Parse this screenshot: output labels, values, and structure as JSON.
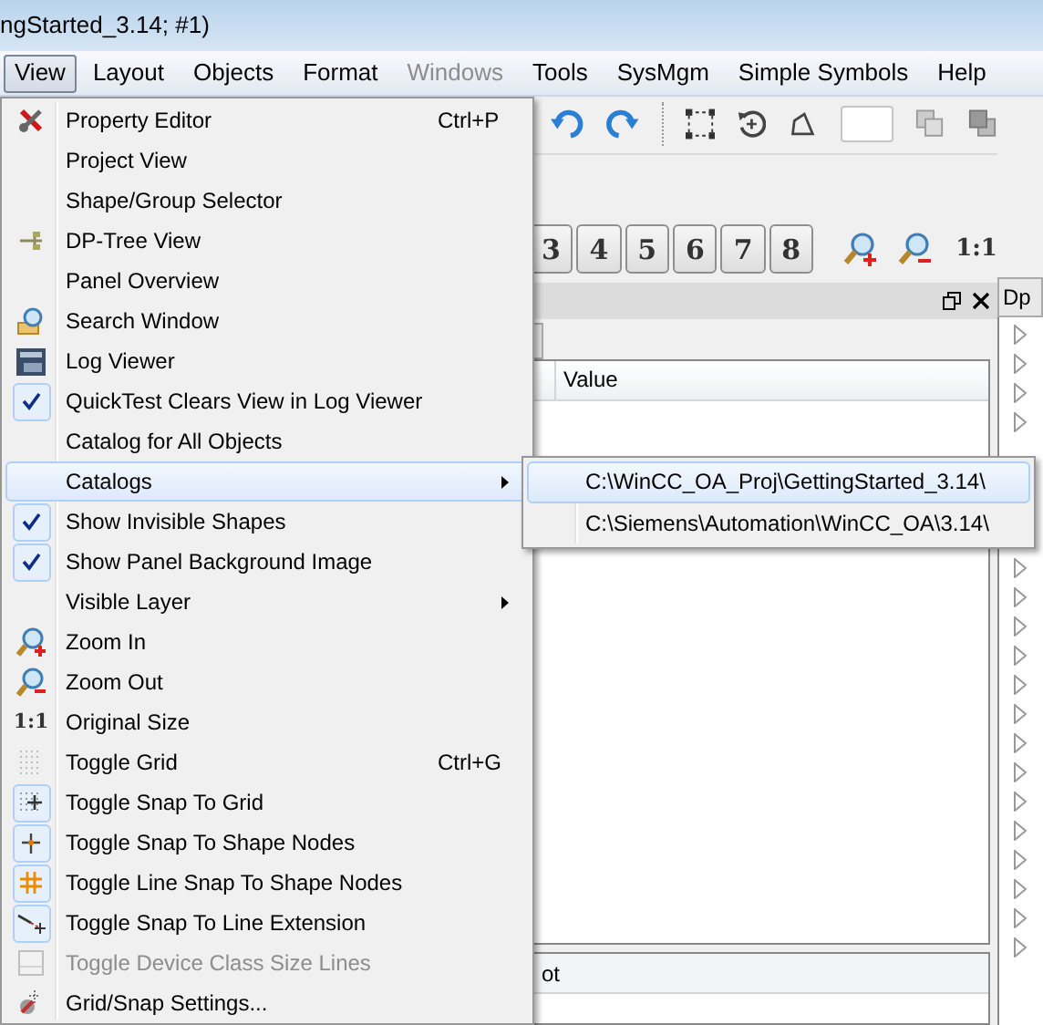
{
  "window": {
    "title": "ngStarted_3.14; #1)"
  },
  "menubar": [
    {
      "label": "View",
      "selected": true,
      "disabled": false
    },
    {
      "label": "Layout",
      "selected": false,
      "disabled": false
    },
    {
      "label": "Objects",
      "selected": false,
      "disabled": false
    },
    {
      "label": "Format",
      "selected": false,
      "disabled": false
    },
    {
      "label": "Windows",
      "selected": false,
      "disabled": true
    },
    {
      "label": "Tools",
      "selected": false,
      "disabled": false
    },
    {
      "label": "SysMgm",
      "selected": false,
      "disabled": false
    },
    {
      "label": "Simple Symbols",
      "selected": false,
      "disabled": false
    },
    {
      "label": "Help",
      "selected": false,
      "disabled": false
    }
  ],
  "background": {
    "layer_buttons": [
      "3",
      "4",
      "5",
      "6",
      "7",
      "8"
    ],
    "zoom_label": "1:1",
    "table_column": "Value",
    "side_tab": "Dp",
    "bottom_header": "ot"
  },
  "view_menu": [
    {
      "label": "Property Editor",
      "shortcut": "Ctrl+P",
      "checked": false,
      "disabled": false,
      "selected": false,
      "submenu": false
    },
    {
      "label": "Project View",
      "checked": false,
      "disabled": false,
      "selected": false,
      "submenu": false
    },
    {
      "label": "Shape/Group Selector",
      "checked": false,
      "disabled": false,
      "selected": false,
      "submenu": false
    },
    {
      "label": "DP-Tree View",
      "checked": false,
      "disabled": false,
      "selected": false,
      "submenu": false
    },
    {
      "label": "Panel Overview",
      "checked": false,
      "disabled": false,
      "selected": false,
      "submenu": false
    },
    {
      "label": "Search Window",
      "checked": false,
      "disabled": false,
      "selected": false,
      "submenu": false
    },
    {
      "label": "Log Viewer",
      "checked": false,
      "disabled": false,
      "selected": false,
      "submenu": false
    },
    {
      "label": "QuickTest Clears View in Log Viewer",
      "checked": true,
      "disabled": false,
      "selected": false,
      "submenu": false
    },
    {
      "label": "Catalog for All Objects",
      "checked": false,
      "disabled": false,
      "selected": false,
      "submenu": false
    },
    {
      "label": "Catalogs",
      "checked": false,
      "disabled": false,
      "selected": true,
      "submenu": true
    },
    {
      "label": "Show Invisible Shapes",
      "checked": true,
      "disabled": false,
      "selected": false,
      "submenu": false
    },
    {
      "label": "Show Panel Background Image",
      "checked": true,
      "disabled": false,
      "selected": false,
      "submenu": false
    },
    {
      "label": "Visible Layer",
      "checked": false,
      "disabled": false,
      "selected": false,
      "submenu": true
    },
    {
      "label": "Zoom In",
      "checked": false,
      "disabled": false,
      "selected": false,
      "submenu": false
    },
    {
      "label": "Zoom Out",
      "checked": false,
      "disabled": false,
      "selected": false,
      "submenu": false
    },
    {
      "label": "Original Size",
      "glyph": "1:1",
      "checked": false,
      "disabled": false,
      "selected": false,
      "submenu": false
    },
    {
      "label": "Toggle Grid",
      "shortcut": "Ctrl+G",
      "checked": false,
      "disabled": false,
      "selected": false,
      "submenu": false
    },
    {
      "label": "Toggle Snap To Grid",
      "checked": true,
      "disabled": false,
      "selected": false,
      "submenu": false
    },
    {
      "label": "Toggle Snap To Shape Nodes",
      "checked": true,
      "disabled": false,
      "selected": false,
      "submenu": false
    },
    {
      "label": "Toggle Line Snap To Shape Nodes",
      "checked": true,
      "disabled": false,
      "selected": false,
      "submenu": false
    },
    {
      "label": "Toggle Snap To Line Extension",
      "checked": true,
      "disabled": false,
      "selected": false,
      "submenu": false
    },
    {
      "label": "Toggle Device Class Size Lines",
      "checked": false,
      "disabled": true,
      "selected": false,
      "submenu": false
    },
    {
      "label": "Grid/Snap Settings...",
      "checked": false,
      "disabled": false,
      "selected": false,
      "submenu": false
    }
  ],
  "catalogs_submenu": [
    {
      "label": "C:\\WinCC_OA_Proj\\GettingStarted_3.14\\",
      "selected": true
    },
    {
      "label": "C:\\Siemens\\Automation\\WinCC_OA\\3.14\\",
      "selected": false
    }
  ]
}
